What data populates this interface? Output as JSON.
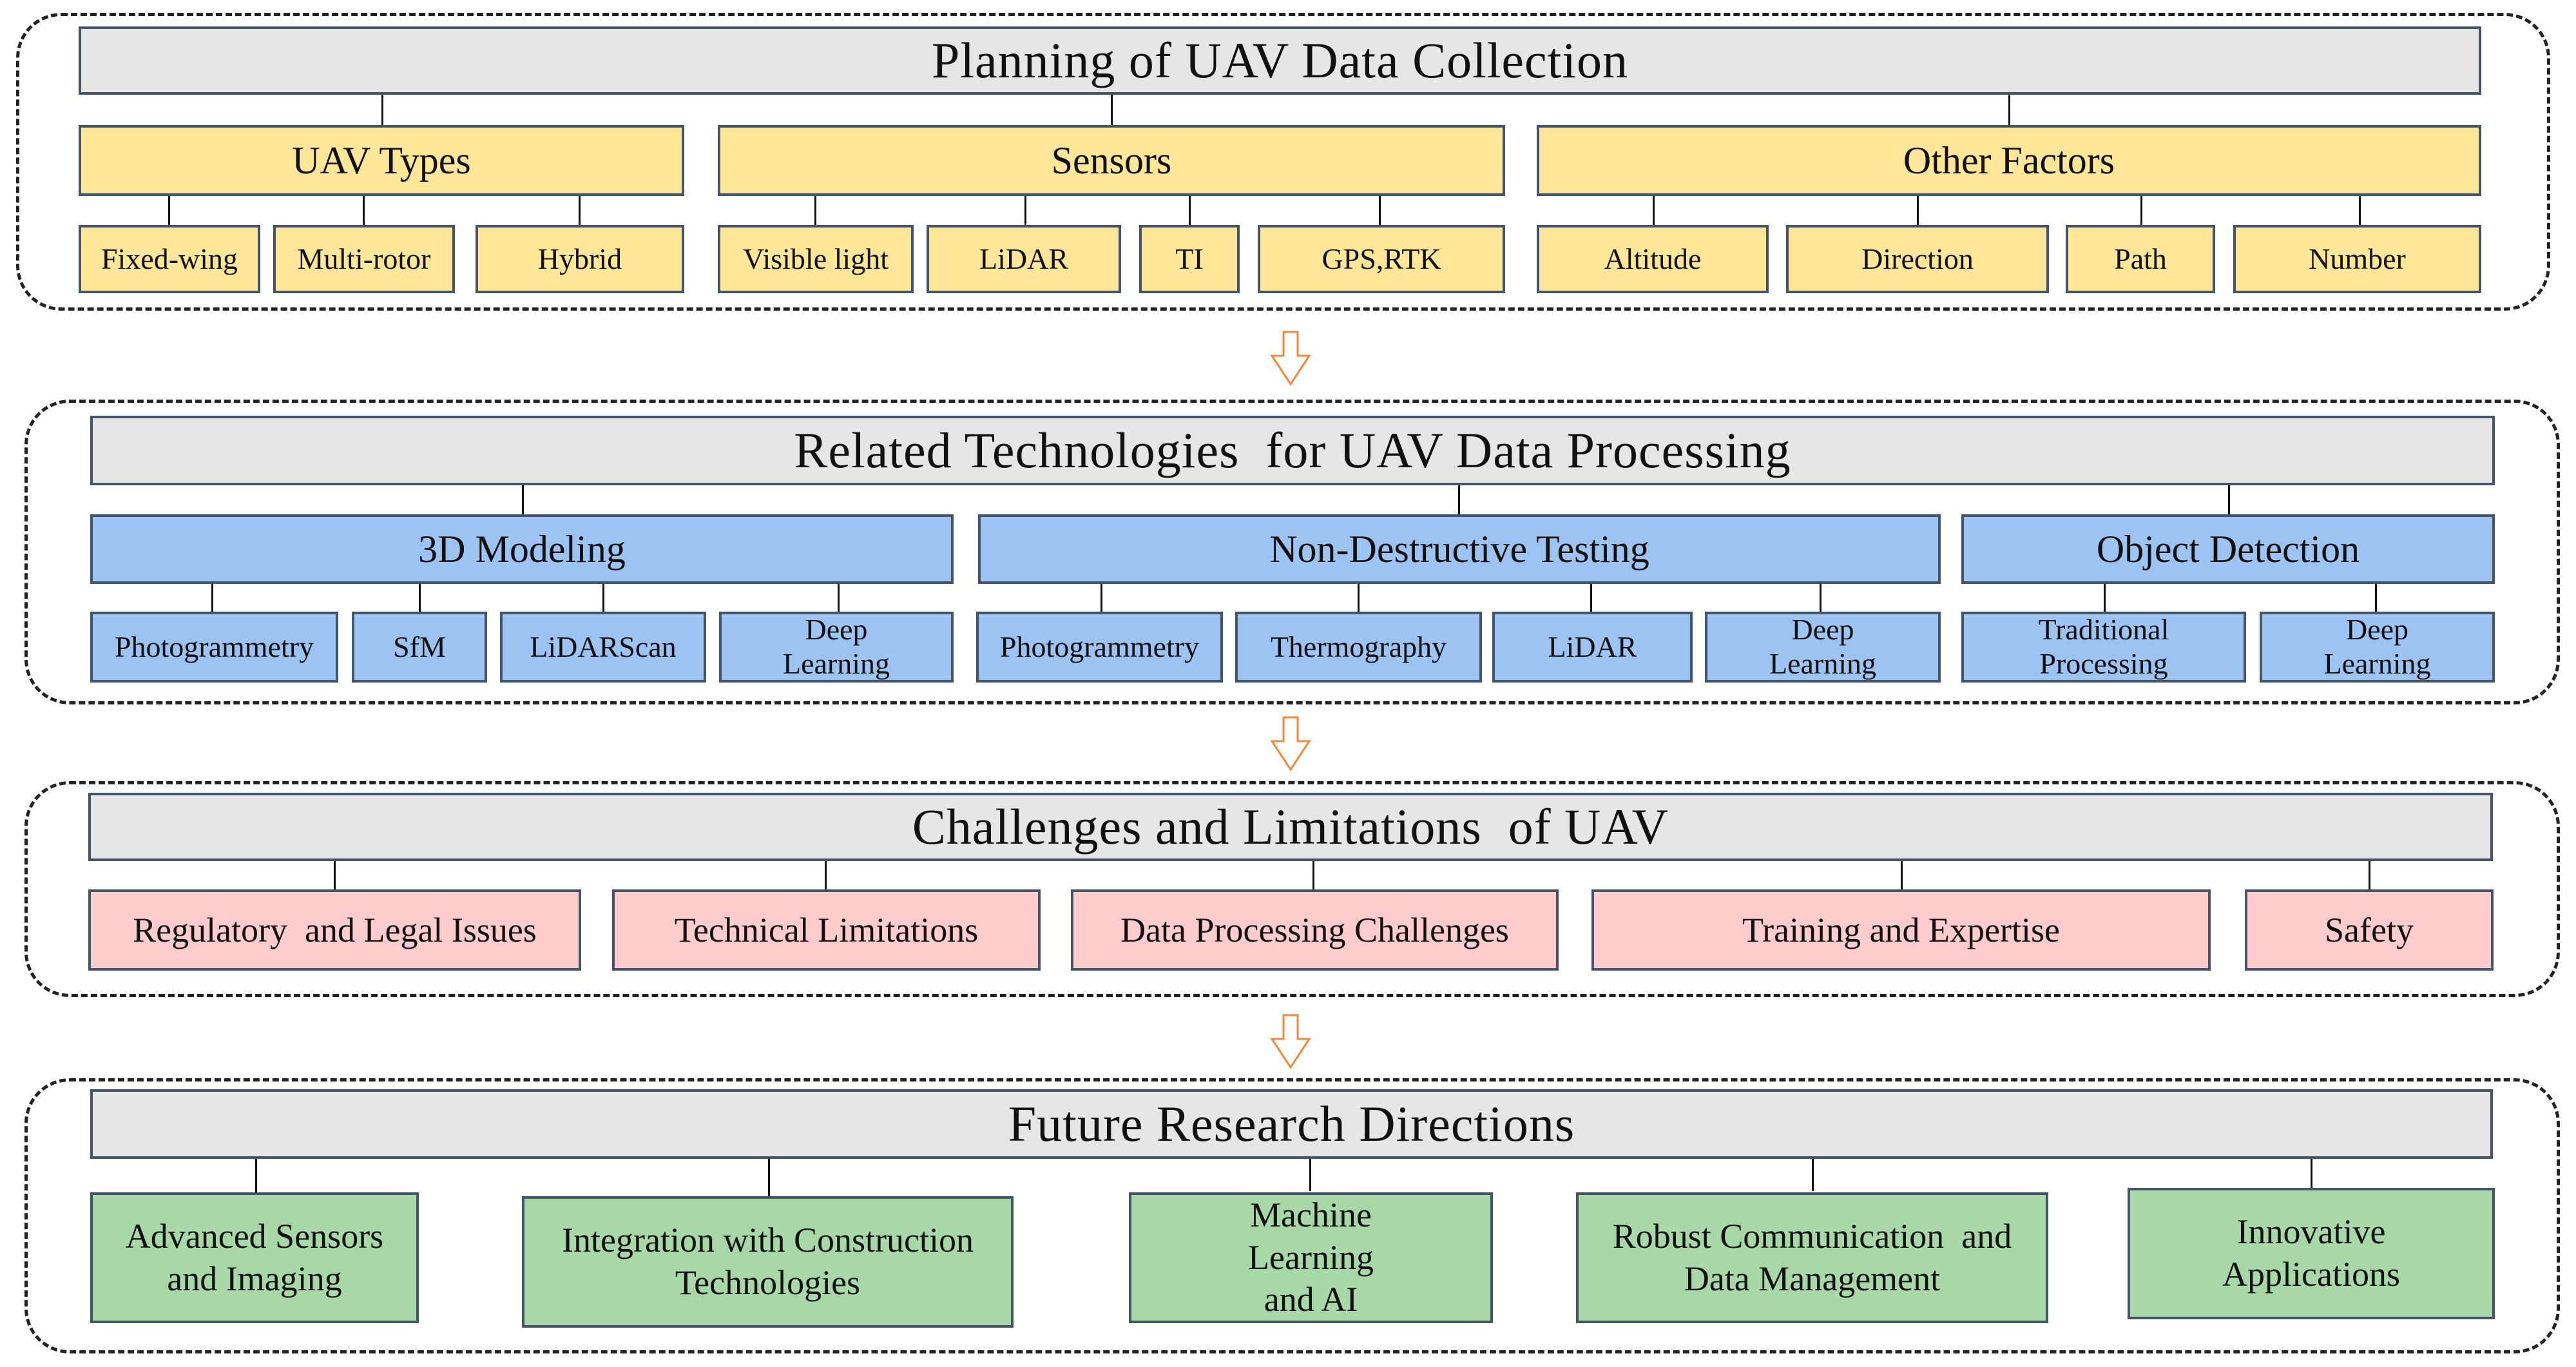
{
  "colors": {
    "header_fill": "#E6E6E6",
    "collection_fill": "#FFE699",
    "processing_fill": "#9DC3F3",
    "challenges_fill": "#FFCCCD",
    "future_fill": "#A8D8A7",
    "box_border": "#44546A",
    "arrow": "#F4883A"
  },
  "sections": {
    "collection": {
      "title": "Planning of UAV Data Collection",
      "groups": [
        {
          "label": "UAV Types",
          "items": [
            "Fixed-wing",
            "Multi-rotor",
            "Hybrid"
          ]
        },
        {
          "label": "Sensors",
          "items": [
            "Visible light",
            "LiDAR",
            "TI",
            "GPS,RTK"
          ]
        },
        {
          "label": "Other Factors",
          "items": [
            "Altitude",
            "Direction",
            "Path",
            "Number"
          ]
        }
      ]
    },
    "processing": {
      "title": "Related Technologies  for UAV Data Processing",
      "groups": [
        {
          "label": "3D Modeling",
          "items": [
            "Photogrammetry",
            "SfM",
            "LiDARScan",
            "Deep\nLearning"
          ]
        },
        {
          "label": "Non-Destructive Testing",
          "items": [
            "Photogrammetry",
            "Thermography",
            "LiDAR",
            "Deep\nLearning"
          ]
        },
        {
          "label": "Object Detection",
          "items": [
            "Traditional\nProcessing",
            "Deep\nLearning"
          ]
        }
      ]
    },
    "challenges": {
      "title": "Challenges and Limitations  of UAV",
      "items": [
        "Regulatory  and Legal Issues",
        "Technical Limitations",
        "Data Processing Challenges",
        "Training and Expertise",
        "Safety"
      ]
    },
    "future": {
      "title": "Future Research Directions",
      "items": [
        "Advanced Sensors\nand Imaging",
        "Integration with Construction\nTechnologies",
        "Machine\nLearning\nand AI",
        "Robust Communication  and\nData Management",
        "Innovative\nApplications"
      ]
    }
  },
  "flow_arrows": [
    "down-arrow",
    "down-arrow",
    "down-arrow"
  ]
}
